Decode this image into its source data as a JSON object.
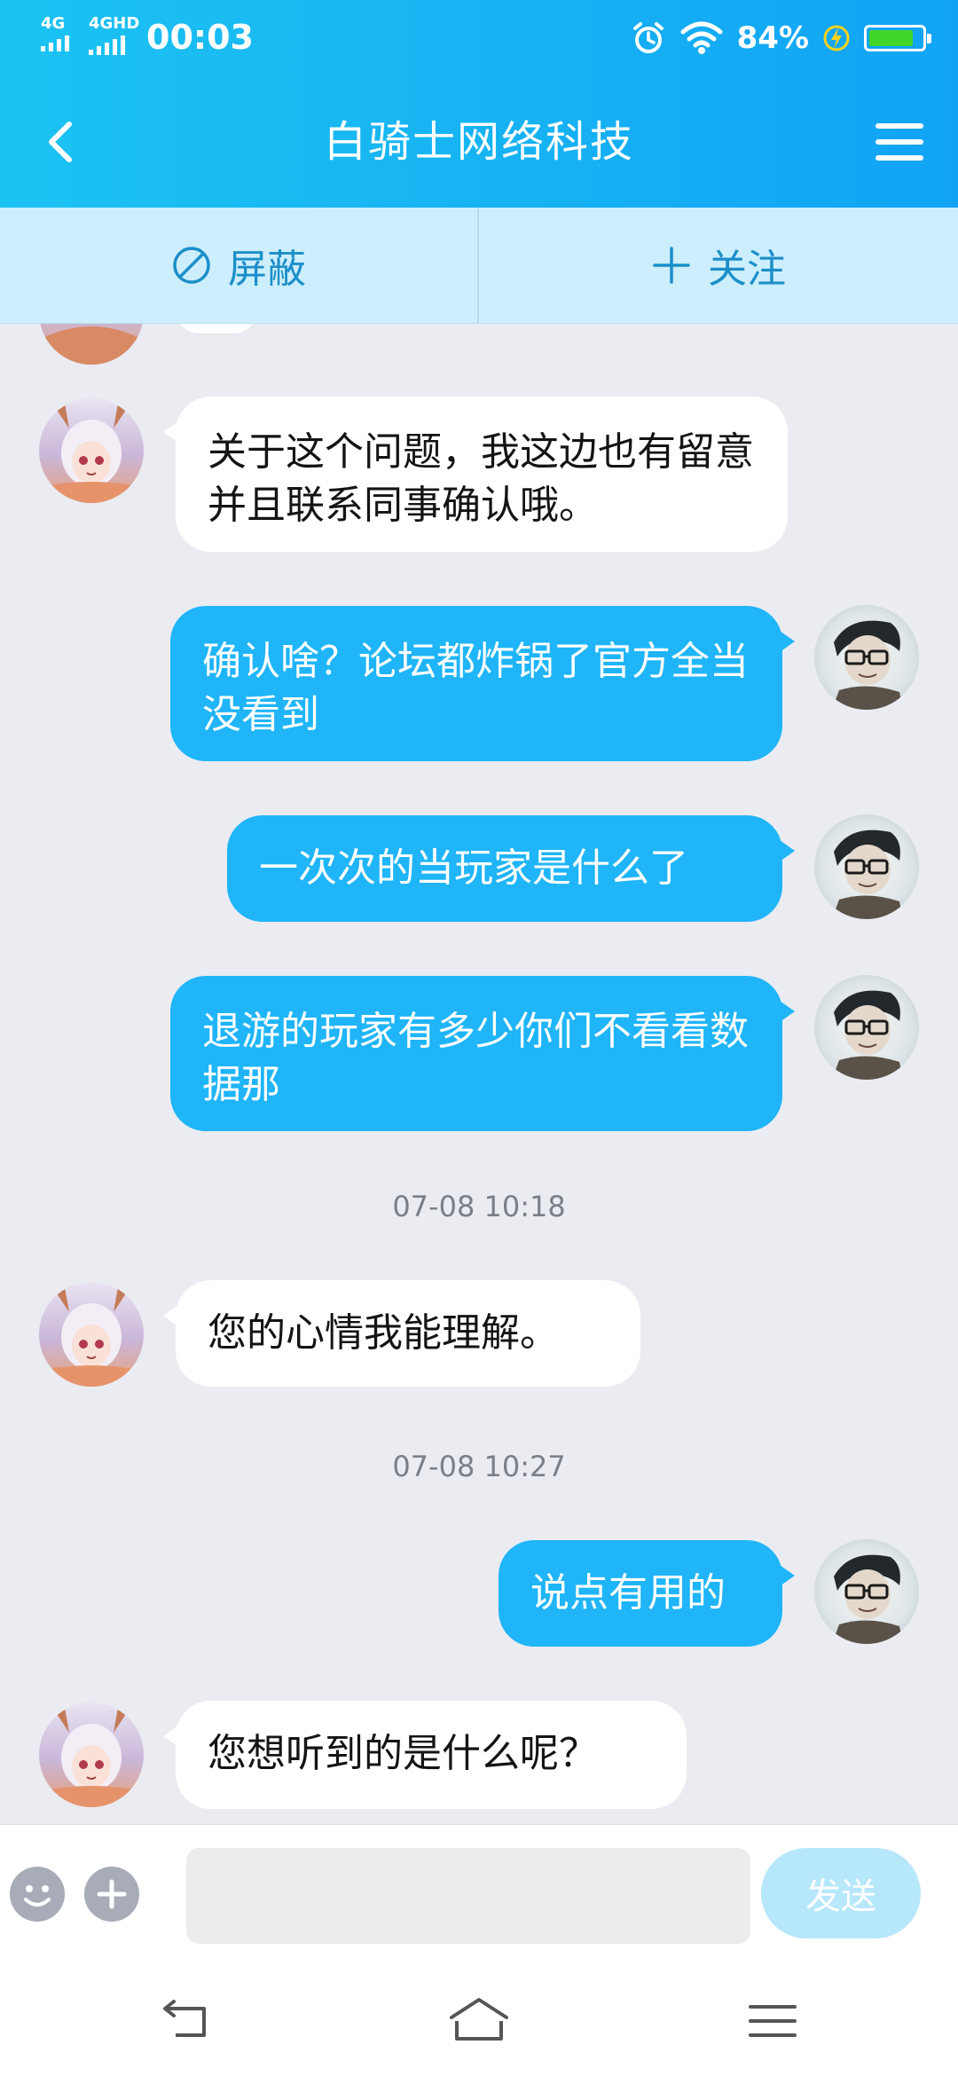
{
  "status_bar": {
    "signal_1": "4G",
    "signal_2": "4GHD",
    "time": "00:03",
    "battery": "84%",
    "battery_level": 0.84
  },
  "header": {
    "title": "白骑士网络科技"
  },
  "actions": {
    "block_label": "屏蔽",
    "follow_label": "关注"
  },
  "messages": [
    {
      "side": "in",
      "text": "关于这个问题，我这边也有留意并且联系同事确认哦。"
    },
    {
      "side": "out",
      "text": "确认啥？论坛都炸锅了官方全当没看到"
    },
    {
      "side": "out",
      "text": "一次次的当玩家是什么了"
    },
    {
      "side": "out",
      "text": "退游的玩家有多少你们不看看数据那"
    },
    {
      "side": "in",
      "text": "您的心情我能理解。"
    },
    {
      "side": "out",
      "text": "说点有用的"
    },
    {
      "side": "in",
      "text": "您想听到的是什么呢？"
    }
  ],
  "timestamps": [
    "07-08 10:18",
    "07-08 10:27"
  ],
  "input": {
    "value": "",
    "send_label": "发送"
  },
  "colors": {
    "header": "#16b2f3",
    "action_bar": "#cdeefc",
    "outgoing_bubble": "#1fb5f8",
    "incoming_bubble": "#ffffff",
    "send_button": "#b7e7fb"
  },
  "icons": [
    "back-icon",
    "menu-icon",
    "block-icon",
    "plus-icon",
    "emoji-icon",
    "add-icon",
    "alarm-icon",
    "wifi-icon",
    "charging-icon",
    "nav-back-icon",
    "nav-home-icon",
    "nav-menu-icon"
  ]
}
